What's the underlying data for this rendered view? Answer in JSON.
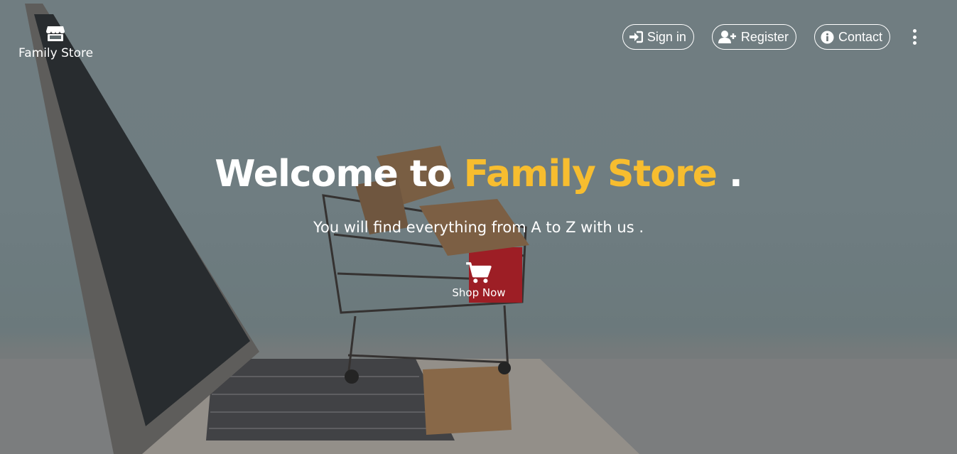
{
  "brand": {
    "name": "Family Store",
    "icon": "store-icon"
  },
  "nav": {
    "signin": {
      "label": "Sign in",
      "icon": "sign-in-icon"
    },
    "register": {
      "label": "Register",
      "icon": "user-plus-icon"
    },
    "contact": {
      "label": "Contact",
      "icon": "info-icon"
    },
    "more_icon": "more-vertical-icon"
  },
  "hero": {
    "headline_prefix": "Welcome to",
    "headline_accent": "Family Store",
    "headline_suffix": ".",
    "subtitle": "You will find everything from A to Z with us .",
    "cta_label": "Shop Now",
    "cta_icon": "shopping-cart-icon"
  },
  "colors": {
    "accent": "#f7bd2f",
    "text": "#ffffff"
  }
}
